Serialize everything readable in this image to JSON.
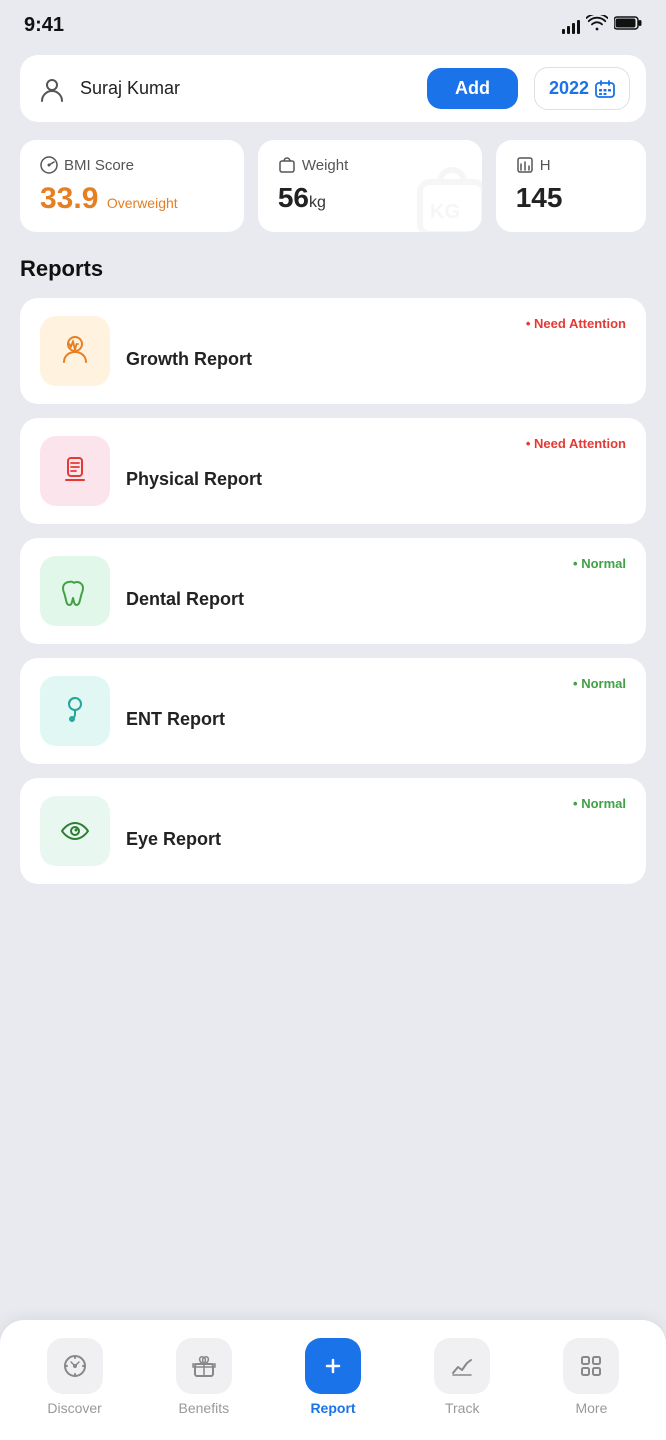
{
  "statusBar": {
    "time": "9:41"
  },
  "topBar": {
    "userName": "Suraj Kumar",
    "addLabel": "Add",
    "yearLabel": "2022"
  },
  "metrics": {
    "bmi": {
      "label": "BMI Score",
      "value": "33.9",
      "subLabel": "Overweight"
    },
    "weight": {
      "label": "Weight",
      "value": "56",
      "unit": "kg"
    },
    "partial": {
      "label": "H",
      "value": "145"
    }
  },
  "reportsSection": {
    "title": "Reports"
  },
  "reports": [
    {
      "name": "Growth Report",
      "status": "Need Attention",
      "statusType": "attention",
      "iconType": "growth",
      "iconBg": "icon-orange"
    },
    {
      "name": "Physical Report",
      "status": "Need Attention",
      "statusType": "attention",
      "iconType": "physical",
      "iconBg": "icon-pink"
    },
    {
      "name": "Dental Report",
      "status": "Normal",
      "statusType": "normal",
      "iconType": "dental",
      "iconBg": "icon-green"
    },
    {
      "name": "ENT Report",
      "status": "Normal",
      "statusType": "normal",
      "iconType": "ent",
      "iconBg": "icon-teal"
    },
    {
      "name": "Eye Report",
      "status": "Normal",
      "statusType": "normal",
      "iconType": "eye",
      "iconBg": "icon-mint"
    }
  ],
  "bottomNav": {
    "items": [
      {
        "label": "Discover",
        "icon": "compass",
        "active": false
      },
      {
        "label": "Benefits",
        "icon": "gift",
        "active": false
      },
      {
        "label": "Report",
        "icon": "plus",
        "active": true
      },
      {
        "label": "Track",
        "icon": "chart",
        "active": false
      },
      {
        "label": "More",
        "icon": "grid",
        "active": false
      }
    ]
  }
}
